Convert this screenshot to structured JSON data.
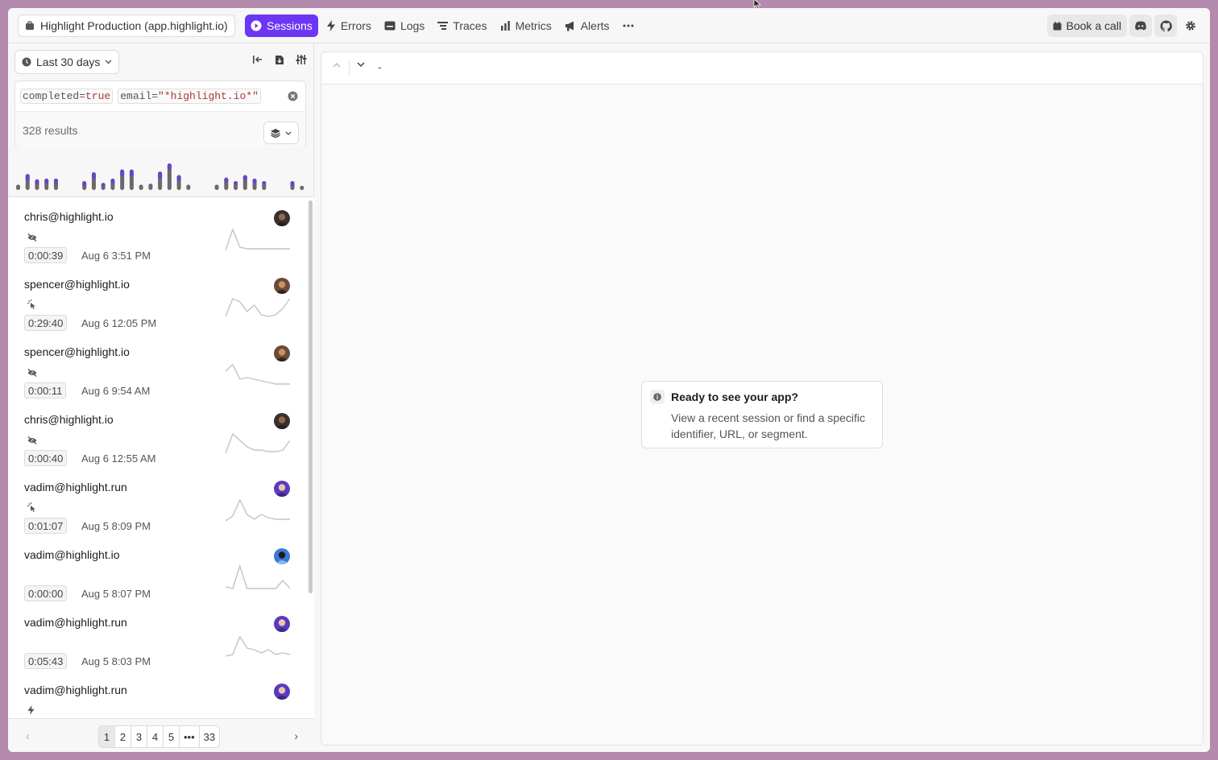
{
  "topbar": {
    "project": "Highlight Production (app.highlight.io)",
    "nav": [
      {
        "label": "Sessions",
        "icon": "play-circle-icon",
        "active": true
      },
      {
        "label": "Errors",
        "icon": "bolt-icon"
      },
      {
        "label": "Logs",
        "icon": "logs-icon"
      },
      {
        "label": "Traces",
        "icon": "traces-icon"
      },
      {
        "label": "Metrics",
        "icon": "bar-chart-icon"
      },
      {
        "label": "Alerts",
        "icon": "megaphone-icon"
      }
    ],
    "book_call": "Book a call"
  },
  "filters": {
    "date_range": "Last 30 days",
    "query_tokens": [
      {
        "key": "completed=",
        "value": "true"
      },
      {
        "key": "email=",
        "value": "\"*highlight.io*\""
      }
    ],
    "results": "328 results"
  },
  "histogram": {
    "bars": [
      [
        0.15,
        0.0
      ],
      [
        0.45,
        0.15
      ],
      [
        0.3,
        0.1
      ],
      [
        0.32,
        0.1
      ],
      [
        0.32,
        0.1
      ],
      [
        0.0,
        0.0
      ],
      [
        0.0,
        0.0
      ],
      [
        0.25,
        0.1
      ],
      [
        0.5,
        0.15
      ],
      [
        0.2,
        0.05
      ],
      [
        0.32,
        0.1
      ],
      [
        0.58,
        0.15
      ],
      [
        0.58,
        0.15
      ],
      [
        0.15,
        0.0
      ],
      [
        0.18,
        0.0
      ],
      [
        0.52,
        0.15
      ],
      [
        0.75,
        0.15
      ],
      [
        0.42,
        0.12
      ],
      [
        0.15,
        0.0
      ],
      [
        0.0,
        0.0
      ],
      [
        0.0,
        0.0
      ],
      [
        0.15,
        0.0
      ],
      [
        0.35,
        0.1
      ],
      [
        0.25,
        0.05
      ],
      [
        0.42,
        0.1
      ],
      [
        0.32,
        0.1
      ],
      [
        0.25,
        0.05
      ],
      [
        0.0,
        0.0
      ],
      [
        0.0,
        0.0
      ],
      [
        0.25,
        0.12
      ],
      [
        0.12,
        0.0
      ]
    ]
  },
  "sessions": [
    {
      "email": "chris@highlight.io",
      "status_icon": "eye-off-icon",
      "duration": "0:00:39",
      "date": "Aug 6 3:51 PM",
      "avatar": "photo-dark",
      "spark": [
        2,
        28,
        6,
        4,
        4,
        4,
        4,
        4,
        4,
        4
      ]
    },
    {
      "email": "spencer@highlight.io",
      "status_icon": "pointer-click-icon",
      "duration": "0:29:40",
      "date": "Aug 6 12:05 PM",
      "avatar": "photo-warm",
      "spark": [
        4,
        26,
        22,
        10,
        18,
        6,
        4,
        6,
        14,
        26
      ]
    },
    {
      "email": "spencer@highlight.io",
      "status_icon": "eye-off-icon",
      "duration": "0:00:11",
      "date": "Aug 6 9:54 AM",
      "avatar": "photo-warm",
      "spark": [
        20,
        28,
        10,
        12,
        10,
        8,
        6,
        4,
        4,
        4
      ]
    },
    {
      "email": "chris@highlight.io",
      "status_icon": "eye-off-icon",
      "duration": "0:00:40",
      "date": "Aug 6 12:55 AM",
      "avatar": "photo-dark",
      "spark": [
        2,
        26,
        18,
        10,
        6,
        6,
        4,
        4,
        6,
        18
      ]
    },
    {
      "email": "vadim@highlight.run",
      "status_icon": "pointer-click-icon",
      "duration": "0:01:07",
      "date": "Aug 5 8:09 PM",
      "avatar": "photo-purple",
      "spark": [
        2,
        8,
        28,
        10,
        4,
        10,
        6,
        4,
        4,
        4
      ]
    },
    {
      "email": "vadim@highlight.io",
      "status_icon": "",
      "duration": "0:00:00",
      "date": "Aug 5 8:07 PM",
      "avatar": "photo-blue",
      "spark": [
        4,
        2,
        30,
        2,
        2,
        2,
        2,
        2,
        12,
        2
      ]
    },
    {
      "email": "vadim@highlight.run",
      "status_icon": "",
      "duration": "0:05:43",
      "date": "Aug 5 8:03 PM",
      "avatar": "photo-purple",
      "spark": [
        2,
        4,
        26,
        12,
        10,
        6,
        10,
        4,
        6,
        4
      ]
    },
    {
      "email": "vadim@highlight.run",
      "status_icon": "bolt-icon",
      "duration": "",
      "date": "",
      "avatar": "photo-purple",
      "spark": [
        2,
        2,
        2,
        2,
        2,
        8,
        2,
        2,
        2,
        2
      ]
    }
  ],
  "pagination": {
    "pages": [
      "1",
      "2",
      "3",
      "4",
      "5",
      "•••",
      "33"
    ],
    "current": "1"
  },
  "player": {
    "placeholder_dash": "-",
    "ready_title": "Ready to see your app?",
    "ready_body": "View a recent session or find a specific identifier, URL, or segment."
  },
  "colors": {
    "accent": "#6c37f4",
    "bar_grey": "#6a6a6a",
    "bar_purple": "#6a44c8",
    "background": "#b48aae"
  }
}
